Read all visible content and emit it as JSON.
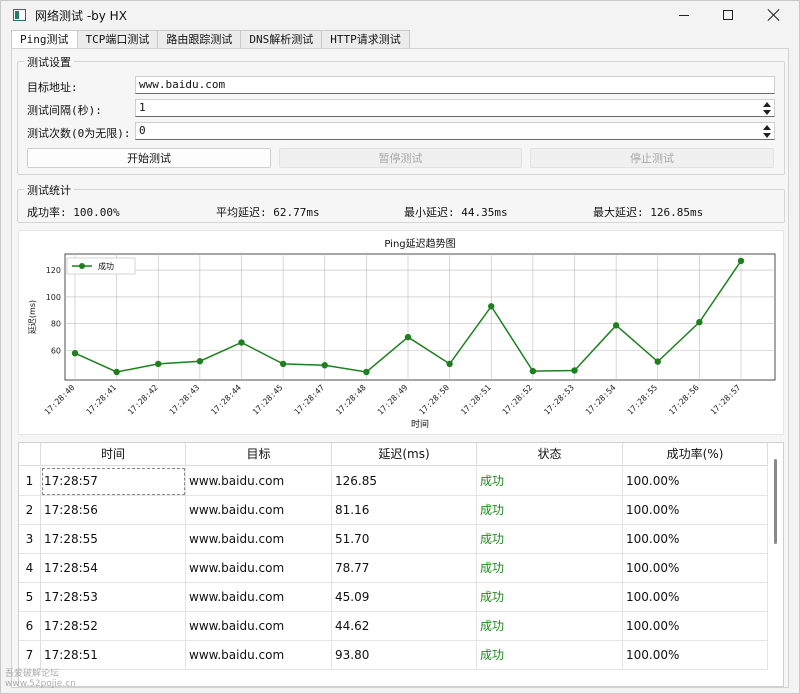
{
  "window": {
    "title": "网络测试 -by HX"
  },
  "tabs": [
    {
      "label": "Ping测试"
    },
    {
      "label": "TCP端口测试"
    },
    {
      "label": "路由跟踪测试"
    },
    {
      "label": "DNS解析测试"
    },
    {
      "label": "HTTP请求测试"
    }
  ],
  "settings": {
    "group_title": "测试设置",
    "target_label": "目标地址:",
    "target_value": "www.baidu.com",
    "interval_label": "测试间隔(秒):",
    "interval_value": "1",
    "count_label": "测试次数(0为无限):",
    "count_value": "0",
    "start_label": "开始测试",
    "pause_label": "暂停测试",
    "stop_label": "停止测试"
  },
  "stats": {
    "group_title": "测试统计",
    "success_rate": "成功率: 100.00%",
    "avg_latency": "平均延迟: 62.77ms",
    "min_latency": "最小延迟: 44.35ms",
    "max_latency": "最大延迟: 126.85ms"
  },
  "chart_data": {
    "type": "line",
    "title": "Ping延迟趋势图",
    "xlabel": "时间",
    "ylabel": "延迟(ms)",
    "x": [
      "17:28:40",
      "17:28:41",
      "17:28:42",
      "17:28:43",
      "17:28:44",
      "17:28:45",
      "17:28:47",
      "17:28:48",
      "17:28:49",
      "17:28:50",
      "17:28:51",
      "17:28:52",
      "17:28:53",
      "17:28:54",
      "17:28:55",
      "17:28:56",
      "17:28:57"
    ],
    "series": [
      {
        "name": "成功",
        "color": "#1e7f1e",
        "values": [
          58,
          44,
          50,
          52,
          66,
          50,
          49,
          44,
          70,
          50,
          93,
          44.62,
          45.09,
          78.77,
          51.7,
          81.16,
          126.85
        ]
      }
    ],
    "ylim": [
      38,
      132
    ],
    "yticks": [
      60,
      80,
      100,
      120
    ],
    "grid": true,
    "legend": "top-left"
  },
  "table": {
    "columns": [
      "时间",
      "目标",
      "延迟(ms)",
      "状态",
      "成功率(%)"
    ],
    "rows": [
      {
        "num": "1",
        "time": "17:28:57",
        "target": "www.baidu.com",
        "latency": "126.85",
        "status": "成功",
        "rate": "100.00%"
      },
      {
        "num": "2",
        "time": "17:28:56",
        "target": "www.baidu.com",
        "latency": "81.16",
        "status": "成功",
        "rate": "100.00%"
      },
      {
        "num": "3",
        "time": "17:28:55",
        "target": "www.baidu.com",
        "latency": "51.70",
        "status": "成功",
        "rate": "100.00%"
      },
      {
        "num": "4",
        "time": "17:28:54",
        "target": "www.baidu.com",
        "latency": "78.77",
        "status": "成功",
        "rate": "100.00%"
      },
      {
        "num": "5",
        "time": "17:28:53",
        "target": "www.baidu.com",
        "latency": "45.09",
        "status": "成功",
        "rate": "100.00%"
      },
      {
        "num": "6",
        "time": "17:28:52",
        "target": "www.baidu.com",
        "latency": "44.62",
        "status": "成功",
        "rate": "100.00%"
      },
      {
        "num": "7",
        "time": "17:28:51",
        "target": "www.baidu.com",
        "latency": "93.80",
        "status": "成功",
        "rate": "100.00%"
      }
    ]
  },
  "watermark": {
    "line1": "吾爱破解论坛",
    "line2": "www.52pojie.cn"
  }
}
